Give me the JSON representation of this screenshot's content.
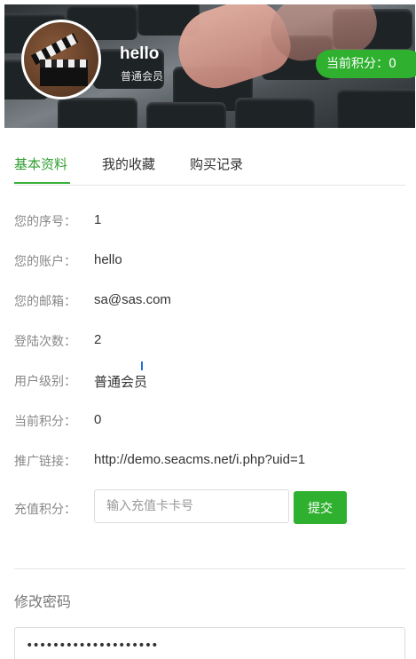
{
  "header": {
    "username": "hello",
    "level": "普通会员",
    "points_badge": "当前积分：0"
  },
  "tabs": [
    {
      "label": "基本资料",
      "active": true
    },
    {
      "label": "我的收藏",
      "active": false
    },
    {
      "label": "购买记录",
      "active": false
    }
  ],
  "profile": {
    "rows": [
      {
        "label": "您的序号：",
        "value": "1"
      },
      {
        "label": "您的账户：",
        "value": "hello"
      },
      {
        "label": "您的邮箱：",
        "value": "sa@sas.com"
      },
      {
        "label": "登陆次数：",
        "value": "2"
      },
      {
        "label": "用户级别：",
        "value": "普通会员"
      },
      {
        "label": "当前积分：",
        "value": "0"
      },
      {
        "label": "推广链接：",
        "value": "http://demo.seacms.net/i.php?uid=1"
      }
    ],
    "recharge": {
      "label": "充值积分：",
      "placeholder": "输入充值卡卡号",
      "submit": "提交"
    }
  },
  "password": {
    "title": "修改密码",
    "value": "••••••••••••••••••••"
  },
  "colors": {
    "accent": "#2fb02f",
    "tab_active": "#33a033"
  }
}
